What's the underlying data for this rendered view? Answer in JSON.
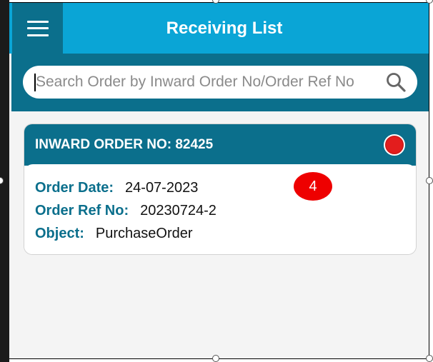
{
  "header": {
    "title": "Receiving List",
    "menu_icon": "hamburger-menu-icon"
  },
  "search": {
    "placeholder": "Search Order by Inward Order No/Order Ref No",
    "value": "",
    "icon": "search-icon"
  },
  "orders": [
    {
      "title": "INWARD ORDER NO: 82425",
      "status_color": "#e31d1d",
      "fields": [
        {
          "label": "Order Date:",
          "value": "24-07-2023"
        },
        {
          "label": "Order Ref No:",
          "value": "20230724-2"
        },
        {
          "label": "Object:",
          "value": "PurchaseOrder"
        }
      ]
    }
  ],
  "badge": {
    "count": "4",
    "color": "#ee0000"
  },
  "colors": {
    "header_bg": "#0aa5d6",
    "dark_teal": "#0b6f8c",
    "page_bg": "#f4f4f4"
  }
}
